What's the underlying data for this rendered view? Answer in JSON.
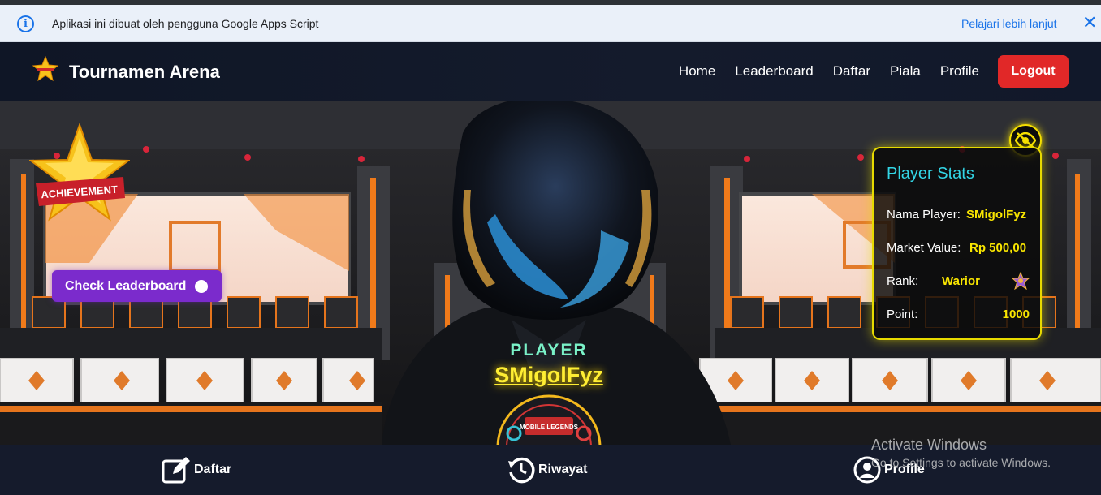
{
  "infobar": {
    "message": "Aplikasi ini dibuat oleh pengguna Google Apps Script",
    "learn_more": "Pelajari lebih lanjut",
    "close_glyph": "✕"
  },
  "navbar": {
    "brand": "Tournamen Arena",
    "links": [
      "Home",
      "Leaderboard",
      "Daftar",
      "Piala",
      "Profile"
    ],
    "logout": "Logout"
  },
  "hero": {
    "achievement_text": "ACHIEVEMENT",
    "check_leaderboard": "Check Leaderboard",
    "player_label": "PLAYER",
    "player_name": "SMigolFyz",
    "logo_text": "MOBILE LEGENDS"
  },
  "stats": {
    "title": "Player Stats",
    "name_label": "Nama Player:",
    "name_value": "SMigolFyz",
    "market_label": "Market Value:",
    "market_value": "Rp 500,00",
    "rank_label": "Rank:",
    "rank_value": "Warior",
    "point_label": "Point:",
    "point_value": "1000"
  },
  "bottom_nav": {
    "items": [
      "Daftar",
      "Riwayat",
      "Profile"
    ]
  },
  "watermark": {
    "line1": "Activate Windows",
    "line2": "Go to Settings to activate Windows."
  },
  "colors": {
    "accent_yellow": "#f9e600",
    "logout_red": "#e12828",
    "purple_button": "#7b2bcc",
    "stats_title": "#33d6e6"
  }
}
